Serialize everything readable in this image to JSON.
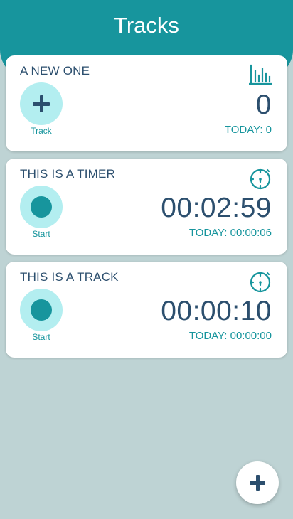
{
  "header": {
    "title": "Tracks"
  },
  "cards": [
    {
      "name": "A NEW ONE",
      "icon": "bar-chart-icon",
      "action_label": "Track",
      "value": "0",
      "today": "TODAY: 0"
    },
    {
      "name": "THIS IS A TIMER",
      "icon": "stopwatch-icon",
      "action_label": "Start",
      "value": "00:02:59",
      "today": "TODAY: 00:00:06"
    },
    {
      "name": "THIS IS A TRACK",
      "icon": "stopwatch-icon",
      "action_label": "Start",
      "value": "00:00:10",
      "today": "TODAY: 00:00:00"
    }
  ],
  "fab": {
    "icon": "plus-icon"
  },
  "colors": {
    "background": "#bed3d4",
    "accent": "#17959d",
    "light_accent": "#b3eef0",
    "text_dark": "#2c4f6e",
    "card": "#ffffff"
  }
}
